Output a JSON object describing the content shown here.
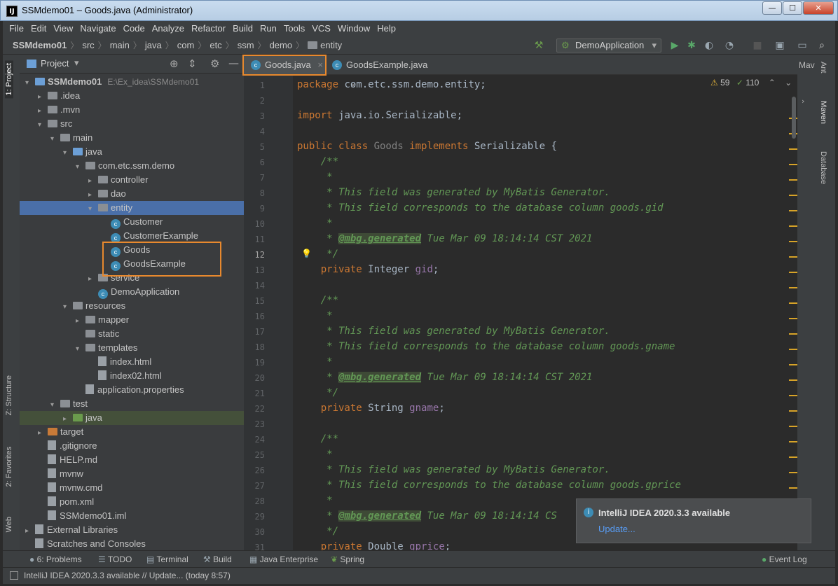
{
  "window": {
    "title": "SSMdemo01 – Goods.java (Administrator)",
    "min_label": "—",
    "max_label": "☐",
    "close_label": "✕"
  },
  "menu": [
    "File",
    "Edit",
    "View",
    "Navigate",
    "Code",
    "Analyze",
    "Refactor",
    "Build",
    "Run",
    "Tools",
    "VCS",
    "Window",
    "Help"
  ],
  "breadcrumbs": [
    "SSMdemo01",
    "src",
    "main",
    "java",
    "com",
    "etc",
    "ssm",
    "demo",
    "entity"
  ],
  "run_config": "DemoApplication",
  "left_tabs": {
    "project": "1: Project",
    "structure": "Z: Structure",
    "favorites": "2: Favorites",
    "web": "Web"
  },
  "project_panel": {
    "title": "Project",
    "dropdown": "▾"
  },
  "tree": [
    {
      "label": "SSMdemo01",
      "extra": "E:\\Ex_idea\\SSMdemo01",
      "depth": 0,
      "arrow": "▾",
      "icon": "folder blue",
      "bold": true
    },
    {
      "label": ".idea",
      "depth": 1,
      "arrow": "▸",
      "icon": "folder"
    },
    {
      "label": ".mvn",
      "depth": 1,
      "arrow": "▸",
      "icon": "folder"
    },
    {
      "label": "src",
      "depth": 1,
      "arrow": "▾",
      "icon": "folder"
    },
    {
      "label": "main",
      "depth": 2,
      "arrow": "▾",
      "icon": "folder"
    },
    {
      "label": "java",
      "depth": 3,
      "arrow": "▾",
      "icon": "folder blue"
    },
    {
      "label": "com.etc.ssm.demo",
      "depth": 4,
      "arrow": "▾",
      "icon": "folder"
    },
    {
      "label": "controller",
      "depth": 5,
      "arrow": "▸",
      "icon": "folder"
    },
    {
      "label": "dao",
      "depth": 5,
      "arrow": "▸",
      "icon": "folder"
    },
    {
      "label": "entity",
      "depth": 5,
      "arrow": "▾",
      "icon": "folder",
      "selected": true
    },
    {
      "label": "Customer",
      "depth": 6,
      "arrow": "",
      "icon": "class"
    },
    {
      "label": "CustomerExample",
      "depth": 6,
      "arrow": "",
      "icon": "class"
    },
    {
      "label": "Goods",
      "depth": 6,
      "arrow": "",
      "icon": "class"
    },
    {
      "label": "GoodsExample",
      "depth": 6,
      "arrow": "",
      "icon": "class"
    },
    {
      "label": "service",
      "depth": 5,
      "arrow": "▸",
      "icon": "folder"
    },
    {
      "label": "DemoApplication",
      "depth": 5,
      "arrow": "",
      "icon": "class"
    },
    {
      "label": "resources",
      "depth": 3,
      "arrow": "▾",
      "icon": "folder"
    },
    {
      "label": "mapper",
      "depth": 4,
      "arrow": "▸",
      "icon": "folder"
    },
    {
      "label": "static",
      "depth": 4,
      "arrow": "",
      "icon": "folder"
    },
    {
      "label": "templates",
      "depth": 4,
      "arrow": "▾",
      "icon": "folder"
    },
    {
      "label": "index.html",
      "depth": 5,
      "arrow": "",
      "icon": "file"
    },
    {
      "label": "index02.html",
      "depth": 5,
      "arrow": "",
      "icon": "file"
    },
    {
      "label": "application.properties",
      "depth": 4,
      "arrow": "",
      "icon": "file"
    },
    {
      "label": "test",
      "depth": 2,
      "arrow": "▾",
      "icon": "folder"
    },
    {
      "label": "java",
      "depth": 3,
      "arrow": "▸",
      "icon": "folder green",
      "testrow": true
    },
    {
      "label": "target",
      "depth": 1,
      "arrow": "▸",
      "icon": "folder orange"
    },
    {
      "label": ".gitignore",
      "depth": 1,
      "arrow": "",
      "icon": "file"
    },
    {
      "label": "HELP.md",
      "depth": 1,
      "arrow": "",
      "icon": "file"
    },
    {
      "label": "mvnw",
      "depth": 1,
      "arrow": "",
      "icon": "file"
    },
    {
      "label": "mvnw.cmd",
      "depth": 1,
      "arrow": "",
      "icon": "file"
    },
    {
      "label": "pom.xml",
      "depth": 1,
      "arrow": "",
      "icon": "file"
    },
    {
      "label": "SSMdemo01.iml",
      "depth": 1,
      "arrow": "",
      "icon": "file"
    },
    {
      "label": "External Libraries",
      "depth": 0,
      "arrow": "▸",
      "icon": "file"
    },
    {
      "label": "Scratches and Consoles",
      "depth": 0,
      "arrow": "",
      "icon": "file"
    }
  ],
  "tabs": [
    {
      "label": "Goods.java",
      "close": "×"
    },
    {
      "label": "GoodsExample.java",
      "close": "×"
    }
  ],
  "inspections": {
    "warnings": "59",
    "typos": "110"
  },
  "code_lines": [
    [
      [
        "kw",
        "package "
      ],
      [
        "",
        "com.etc.ssm.demo.entity;"
      ]
    ],
    [],
    [
      [
        "kw",
        "import "
      ],
      [
        "",
        "java.io.Serializable;"
      ]
    ],
    [],
    [
      [
        "kw",
        "public class "
      ],
      [
        "cls",
        "Goods "
      ],
      [
        "kw",
        "implements "
      ],
      [
        "",
        "Serializable {"
      ]
    ],
    [
      [
        "cm",
        "    /**"
      ]
    ],
    [
      [
        "cm",
        "     *"
      ]
    ],
    [
      [
        "cm",
        "     * This field was generated by MyBatis Generator."
      ]
    ],
    [
      [
        "cm",
        "     * This field corresponds to the database column goods.gid"
      ]
    ],
    [
      [
        "cm",
        "     *"
      ]
    ],
    [
      [
        "cm",
        "     * "
      ],
      [
        "tag",
        "@mbg.generated"
      ],
      [
        "cm",
        " Tue Mar 09 18:14:14 CST 2021"
      ]
    ],
    [
      [
        "cm",
        "     */"
      ]
    ],
    [
      [
        "kw",
        "    private "
      ],
      [
        "",
        "Integer "
      ],
      [
        "fld",
        "gid"
      ],
      [
        "",
        ";"
      ]
    ],
    [],
    [
      [
        "cm",
        "    /**"
      ]
    ],
    [
      [
        "cm",
        "     *"
      ]
    ],
    [
      [
        "cm",
        "     * This field was generated by MyBatis Generator."
      ]
    ],
    [
      [
        "cm",
        "     * This field corresponds to the database column goods.gname"
      ]
    ],
    [
      [
        "cm",
        "     *"
      ]
    ],
    [
      [
        "cm",
        "     * "
      ],
      [
        "tag",
        "@mbg.generated"
      ],
      [
        "cm",
        " Tue Mar 09 18:14:14 CST 2021"
      ]
    ],
    [
      [
        "cm",
        "     */"
      ]
    ],
    [
      [
        "kw",
        "    private "
      ],
      [
        "",
        "String "
      ],
      [
        "fld",
        "gname"
      ],
      [
        "",
        ";"
      ]
    ],
    [],
    [
      [
        "cm",
        "    /**"
      ]
    ],
    [
      [
        "cm",
        "     *"
      ]
    ],
    [
      [
        "cm",
        "     * This field was generated by MyBatis Generator."
      ]
    ],
    [
      [
        "cm",
        "     * This field corresponds to the database column goods.gprice"
      ]
    ],
    [
      [
        "cm",
        "     *"
      ]
    ],
    [
      [
        "cm",
        "     * "
      ],
      [
        "tag",
        "@mbg.generated"
      ],
      [
        "cm",
        " Tue Mar 09 18:14:14 CS"
      ]
    ],
    [
      [
        "cm",
        "     */"
      ]
    ],
    [
      [
        "kw",
        "    private "
      ],
      [
        "",
        "Double "
      ],
      [
        "fld",
        "gprice"
      ],
      [
        "",
        ";"
      ]
    ]
  ],
  "right_tabs": {
    "ant": "Ant",
    "maven": "Maven",
    "database": "Database",
    "mav_short": "Mav"
  },
  "notification": {
    "title": "IntelliJ IDEA 2020.3.3 available",
    "link": "Update..."
  },
  "bottom_tools": [
    "6: Problems",
    "TODO",
    "Terminal",
    "Build",
    "Java Enterprise",
    "Spring"
  ],
  "event_log": "Event Log",
  "status_text": "IntelliJ IDEA 2020.3.3 available // Update... (today 8:57)"
}
